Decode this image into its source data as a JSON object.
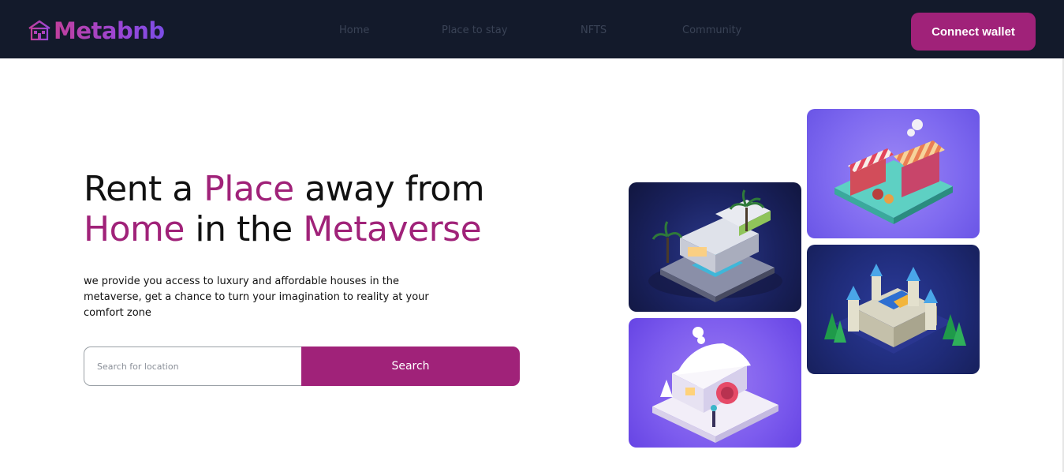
{
  "brand": {
    "name": "Metabnb",
    "icon": "house-icon",
    "colors": {
      "from": "#c13f9c",
      "to": "#7b4de6"
    }
  },
  "nav": {
    "links": [
      "Home",
      "Place to stay",
      "NFTS",
      "Community"
    ],
    "cta_label": "Connect wallet",
    "background": "#131a2b"
  },
  "hero": {
    "headline": {
      "part1": "Rent a ",
      "accent1": "Place",
      "part2": " away from",
      "accent2": "Home",
      "part3": " in the ",
      "accent3": "Metaverse"
    },
    "subtitle": "we provide you access to luxury and affordable houses in the metaverse, get a chance to turn your imagination to reality at your comfort zone",
    "accent_color": "#a02279"
  },
  "search": {
    "placeholder": "Search for location",
    "value": "",
    "button_label": "Search"
  },
  "gallery": {
    "images": [
      {
        "name": "modern-villa-image"
      },
      {
        "name": "market-stall-image"
      },
      {
        "name": "snow-cottage-image"
      },
      {
        "name": "castle-image"
      }
    ]
  }
}
